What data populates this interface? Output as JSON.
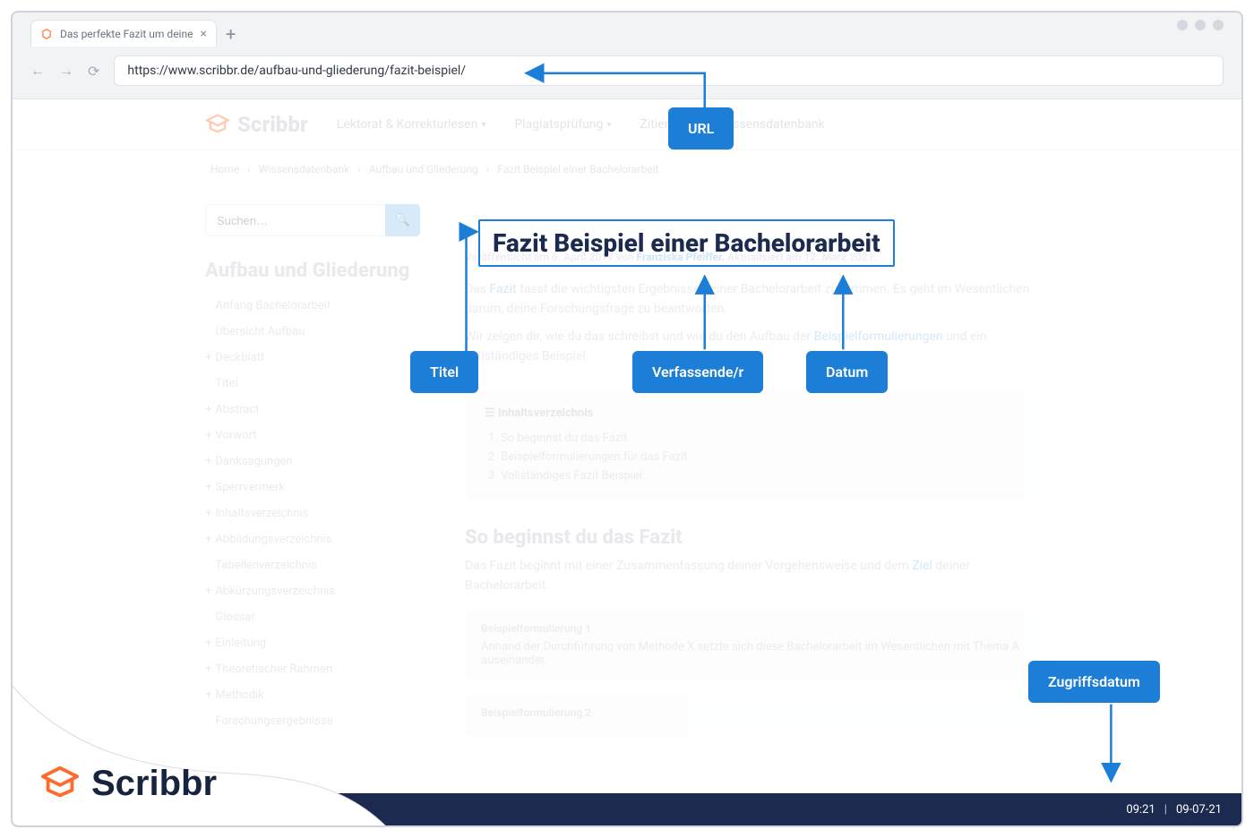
{
  "browser": {
    "tab_title": "Das perfekte Fazit um deine",
    "url": "https://www.scribbr.de/aufbau-und-gliederung/fazit-beispiel/"
  },
  "header": {
    "brand": "Scribbr",
    "menu": [
      "Lektorat & Korrekturlesen",
      "Plagiatsprüfung",
      "Zitieren",
      "Wissensdatenbank"
    ]
  },
  "breadcrumbs": [
    "Home",
    "Wissensdatenbank",
    "Aufbau und Gliederung",
    "Fazit Beispiel einer Bachelorarbeit"
  ],
  "sidebar": {
    "search_placeholder": "Suchen…",
    "heading": "Aufbau und Gliederung",
    "items": [
      {
        "label": "Anfang Bachelorarbeit",
        "plus": false
      },
      {
        "label": "Übersicht Aufbau",
        "plus": false
      },
      {
        "label": "Deckblatt",
        "plus": true
      },
      {
        "label": "Titel",
        "plus": false
      },
      {
        "label": "Abstract",
        "plus": true
      },
      {
        "label": "Vorwort",
        "plus": true
      },
      {
        "label": "Danksagungen",
        "plus": true
      },
      {
        "label": "Sperrvermerk",
        "plus": true
      },
      {
        "label": "Inhaltsverzeichnis",
        "plus": true
      },
      {
        "label": "Abbildungsverzeichnis",
        "plus": true
      },
      {
        "label": "Tabellenverzeichnis",
        "plus": false
      },
      {
        "label": "Abkürzungsverzeichnis",
        "plus": true
      },
      {
        "label": "Glossar",
        "plus": false
      },
      {
        "label": "Einleitung",
        "plus": true
      },
      {
        "label": "Theoretischer Rahmen",
        "plus": true
      },
      {
        "label": "Methodik",
        "plus": true
      },
      {
        "label": "Forschungsergebnisse",
        "plus": false
      }
    ]
  },
  "article": {
    "title": "Fazit Beispiel einer Bachelorarbeit",
    "meta_prefix": "Veröffentlicht am 6. April 2017 von ",
    "author": "Franziska Pfeiffer.",
    "meta_suffix": " Aktualisiert am 12. März 2021.",
    "p1a": "Das ",
    "p1_link1": "Fazit",
    "p1b": " fasst die wichtigsten Ergebnisse deiner Bachelorarbeit zusammen. Es geht im Wesentlichen darum, deine Forschungsfrage zu beantworten.",
    "p2a": "Wir zeigen dir, wie du das schreibst und wie du den Aufbau der ",
    "p2_link": "Beispielformulierungen",
    "p2b": " und ein vollständiges Beispiel.",
    "toc_heading": "Inhaltsverzeichnis",
    "toc": [
      "So beginnst du das Fazit",
      "Beispielformulierungen für das Fazit",
      "Vollständiges Fazit Beispiel"
    ],
    "section_heading": "So beginnst du das Fazit",
    "section_p_a": "Das Fazit beginnt mit einer Zusammenfassung deiner Vorgehensweise und dem ",
    "section_p_link": "Ziel",
    "section_p_b": " deiner Bachelorarbeit.",
    "example1_title": "Beispielformulierung 1",
    "example1_body": "Anhand der Durchführung von Methode X setzte sich diese Bachelorarbeit im Wesentlichen mit Thema A auseinander.",
    "example2_title": "Beispielformulierung 2"
  },
  "callouts": {
    "url": "URL",
    "title": "Titel",
    "author": "Verfassende/r",
    "date": "Datum",
    "access_date": "Zugriffsdatum"
  },
  "taskbar": {
    "time": "09:21",
    "date": "09-07-21"
  },
  "footer_brand": "Scribbr"
}
